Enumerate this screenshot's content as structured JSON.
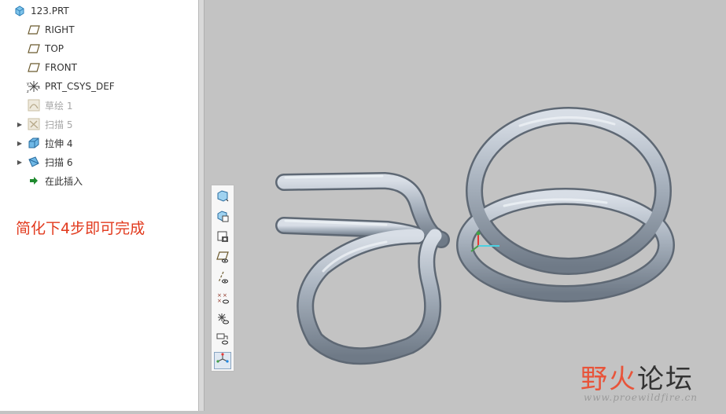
{
  "model_tree": {
    "root": {
      "label": "123.PRT",
      "icon": "part-icon"
    },
    "items": [
      {
        "label": "RIGHT",
        "icon": "datum-plane-icon",
        "enabled": true,
        "expandable": false
      },
      {
        "label": "TOP",
        "icon": "datum-plane-icon",
        "enabled": true,
        "expandable": false
      },
      {
        "label": "FRONT",
        "icon": "datum-plane-icon",
        "enabled": true,
        "expandable": false
      },
      {
        "label": "PRT_CSYS_DEF",
        "icon": "coordinate-system-icon",
        "enabled": true,
        "expandable": false
      },
      {
        "label": "草绘 1",
        "icon": "sketch-icon",
        "enabled": false,
        "expandable": false
      },
      {
        "label": "扫描 5",
        "icon": "sweep-icon",
        "enabled": false,
        "expandable": true
      },
      {
        "label": "拉伸 4",
        "icon": "extrude-icon",
        "enabled": true,
        "expandable": true
      },
      {
        "label": "扫描 6",
        "icon": "sweep-icon",
        "enabled": true,
        "expandable": true
      },
      {
        "label": "在此插入",
        "icon": "insert-here-arrow-icon",
        "enabled": true,
        "expandable": false
      }
    ]
  },
  "annotation": {
    "text": "简化下4步即可完成",
    "color": "#e23a1e"
  },
  "view_toolbar": {
    "buttons": [
      {
        "icon": "refit-icon"
      },
      {
        "icon": "saved-orientations-icon"
      },
      {
        "icon": "display-style-icon"
      },
      {
        "icon": "plane-display-icon"
      },
      {
        "icon": "axis-display-icon"
      },
      {
        "icon": "point-display-icon"
      },
      {
        "icon": "csys-display-icon"
      },
      {
        "icon": "annotation-display-icon"
      },
      {
        "icon": "spin-center-icon",
        "active": true
      }
    ]
  },
  "watermark": {
    "title_part1": "野火",
    "title_part2": "论坛",
    "url": "www.proewildfire.cn",
    "color1": "#e8543a",
    "color2": "#333333"
  },
  "colors": {
    "viewport_bg": "#c3c3c3",
    "wire": "#9aa4b0"
  }
}
